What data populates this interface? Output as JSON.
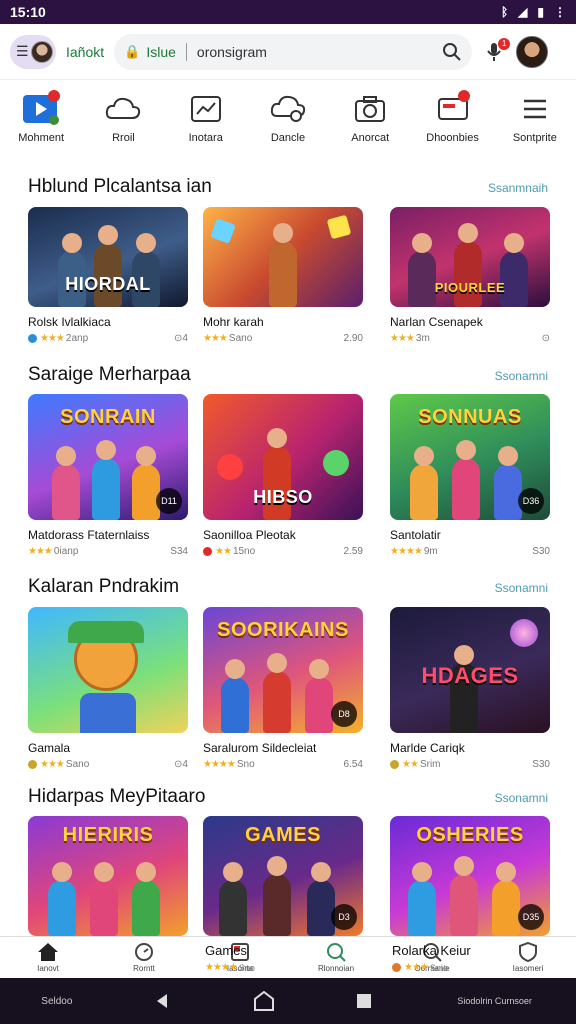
{
  "status_bar": {
    "time": "15:10",
    "icons": [
      "bluetooth-icon",
      "signal-icon",
      "battery-icon",
      "menu-dots-icon"
    ]
  },
  "app_bar": {
    "brand": "Iañokt",
    "url": "Islue",
    "query": "oronsigram"
  },
  "categories": [
    {
      "label": "Mohment",
      "icon": "play-icon",
      "badge": true
    },
    {
      "label": "Rroil",
      "icon": "cloud-icon",
      "badge": false
    },
    {
      "label": "Inotara",
      "icon": "chart-icon",
      "badge": false
    },
    {
      "label": "Dancle",
      "icon": "cloud-sync-icon",
      "badge": false
    },
    {
      "label": "Anorcat",
      "icon": "camera-icon",
      "badge": false
    },
    {
      "label": "Dhoonbies",
      "icon": "card-icon",
      "badge": true
    },
    {
      "label": "Sontprite",
      "icon": "list-icon",
      "badge": false
    }
  ],
  "sections": [
    {
      "title": "Hblund Plcalantsa ian",
      "see_all": "Ssanmnaih",
      "cards": [
        {
          "title": "Rolsk Ivlalkiaca",
          "stars": "★★★",
          "meta": "2anp",
          "right": "⊙4",
          "thumb_text": "HIORDAL"
        },
        {
          "title": "Mohr karah",
          "stars": "★★★",
          "meta": "Sano",
          "right": "2.90",
          "thumb_text": ""
        },
        {
          "title": "Narlan Csenapek",
          "stars": "★★★",
          "meta": "3m",
          "right": "⊙",
          "thumb_text": "PIOURLEE"
        }
      ]
    },
    {
      "title": "Saraige Merharpaa",
      "see_all": "Ssonamni",
      "cards": [
        {
          "title": "Matdorass Ftaternlaiss",
          "stars": "★★★",
          "meta": "0ianp",
          "right": "S34",
          "thumb_text": "SONRAIN",
          "badge": "D11"
        },
        {
          "title": "Saonilloa Pleotak",
          "stars": "★★",
          "meta": "15no",
          "right": "2.59",
          "thumb_text": "HIBSO"
        },
        {
          "title": "Santolatir",
          "stars": "★★★★",
          "meta": "9m",
          "right": "S30",
          "thumb_text": "SONNUAS",
          "badge": "D36"
        }
      ]
    },
    {
      "title": "Kalaran Pndrakim",
      "see_all": "Ssonamni",
      "cards": [
        {
          "title": "Gamala",
          "stars": "★★★",
          "meta": "Sano",
          "right": "⊙4",
          "thumb_text": ""
        },
        {
          "title": "Saralurom Sildecleiat",
          "stars": "★★★★",
          "meta": "Sno",
          "right": "6.54",
          "thumb_text": "SOORIKAINS",
          "badge": "D8"
        },
        {
          "title": "Marlde Cariqk",
          "stars": "★★",
          "meta": "Srim",
          "right": "S30",
          "thumb_text": "HDAGES"
        }
      ]
    },
    {
      "title": "Hidarpas MeyPitaaro",
      "see_all": "Ssonamni",
      "cards": [
        {
          "title": "",
          "stars": "",
          "meta": "",
          "right": "",
          "thumb_text": "HIERIRIS"
        },
        {
          "title": "",
          "stars": "",
          "meta": "",
          "right": "",
          "thumb_text": "GAMES",
          "badge": "D3"
        },
        {
          "title": "",
          "stars": "",
          "meta": "",
          "right": "",
          "thumb_text": "OSHERIES",
          "badge": "D35"
        }
      ]
    }
  ],
  "bottom_nav": {
    "items": [
      {
        "label": "Ianovt",
        "icon": "home-icon"
      },
      {
        "label": "Rorntt",
        "icon": "clock-icon"
      },
      {
        "label": "Iasonta",
        "icon": "app-icon"
      },
      {
        "label": "Rlonnoian",
        "icon": "search-apps-icon"
      },
      {
        "label": "Oorrsanie",
        "icon": "search-icon"
      },
      {
        "label": "Iasomeri",
        "icon": "shield-icon"
      }
    ],
    "overlay_left": {
      "title": "Games",
      "stars": "★★★★",
      "meta": "Sno"
    },
    "overlay_right": {
      "title": "Rolarka Keiur",
      "stars": "★★★",
      "meta": "Snio"
    }
  },
  "system_nav": {
    "left": "Seldoo",
    "right": "Siodolrin Curnsoer"
  }
}
